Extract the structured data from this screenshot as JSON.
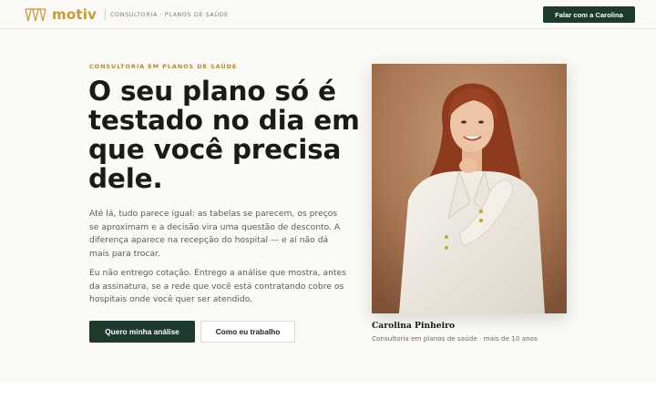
{
  "header": {
    "brand": "motiv",
    "tagline": "CONSULTORIA · PLANOS DE SAÚDE",
    "cta_label": "Falar com a Carolina"
  },
  "hero": {
    "eyebrow": "CONSULTORIA EM PLANOS DE SAÚDE",
    "headline": "O seu plano só é testado no dia em que você precisa dele.",
    "paragraph_1": "Até lá, tudo parece igual: as tabelas se parecem, os preços se aproximam e a decisão vira uma questão de desconto. A diferença aparece na recepção do hospital — e aí não dá mais para trocar.",
    "paragraph_2": "Eu não entrego cotação. Entrego a análise que mostra, antes da assinatura, se a rede que você está contratando cobre os hospitais onde você quer ser atendido.",
    "primary_button": "Quero minha análise",
    "secondary_button": "Como eu trabalho"
  },
  "portrait": {
    "name": "Carolina Pinheiro",
    "role": "Consultoria em planos de saúde · mais de 10 anos"
  },
  "colors": {
    "accent_green": "#1e3a2f",
    "gold": "#c49a3c",
    "background": "#fbfaf7"
  },
  "icons": {
    "logo": "motiv-logo-icon"
  }
}
